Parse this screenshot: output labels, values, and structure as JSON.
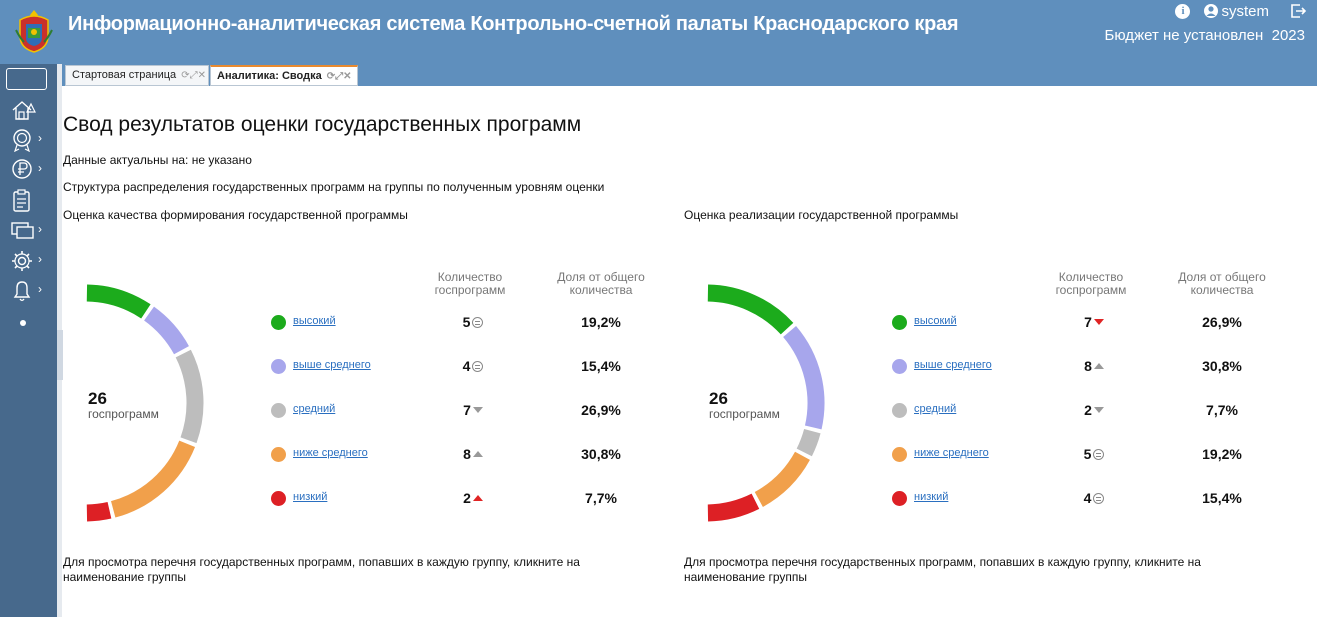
{
  "header": {
    "title": "Информационно-аналитическая система Контрольно-счетной палаты Краснодарского края",
    "user": "system",
    "budget_label": "Бюджет не установлен",
    "year": "2023"
  },
  "sidebar": {
    "items": [
      {
        "icon": "home-trees-icon"
      },
      {
        "icon": "award-icon"
      },
      {
        "icon": "ruble-icon"
      },
      {
        "icon": "clipboard-icon"
      },
      {
        "icon": "screens-icon"
      },
      {
        "icon": "gear-icon"
      },
      {
        "icon": "bell-icon"
      }
    ]
  },
  "tabs": [
    {
      "label": "Стартовая страница",
      "active": false
    },
    {
      "label": "Аналитика: Сводка",
      "active": true
    }
  ],
  "page": {
    "title": "Свод результатов оценки государственных программ",
    "actual_label": "Данные актуальны на:",
    "actual_value": "не указано",
    "structure_text": "Структура распределения государственных программ на группы по полученным уровням оценки"
  },
  "columns": {
    "count": "Количество госпрограмм",
    "share": "Доля от общего количества"
  },
  "colors": {
    "high": "#1cab1c",
    "above": "#a7a6ec",
    "mid": "#bdbdbd",
    "below": "#f1a04b",
    "low": "#dd2025"
  },
  "sections": [
    {
      "title": "Оценка качества формирования государственной программы",
      "total": "26",
      "total_label": "госпрограмм",
      "note": "Для просмотра перечня государственных программ, попавших в каждую группу, кликните на наименование группы",
      "rows": [
        {
          "key": "high",
          "label": "высокий",
          "count": "5",
          "count_value": 5,
          "trend": "equal",
          "share": "19,2%"
        },
        {
          "key": "above",
          "label": "выше среднего",
          "count": "4",
          "count_value": 4,
          "trend": "equal",
          "share": "15,4%"
        },
        {
          "key": "mid",
          "label": "средний",
          "count": "7",
          "count_value": 7,
          "trend": "down",
          "share": "26,9%"
        },
        {
          "key": "below",
          "label": "ниже среднего",
          "count": "8",
          "count_value": 8,
          "trend": "up",
          "share": "30,8%"
        },
        {
          "key": "low",
          "label": "низкий",
          "count": "2",
          "count_value": 2,
          "trend": "up-red",
          "share": "7,7%"
        }
      ]
    },
    {
      "title": "Оценка реализации государственной программы",
      "total": "26",
      "total_label": "госпрограмм",
      "note": "Для просмотра перечня государственных программ, попавших в каждую группу, кликните на наименование группы",
      "rows": [
        {
          "key": "high",
          "label": "высокий",
          "count": "7",
          "count_value": 7,
          "trend": "down-red",
          "share": "26,9%"
        },
        {
          "key": "above",
          "label": "выше среднего",
          "count": "8",
          "count_value": 8,
          "trend": "up",
          "share": "30,8%"
        },
        {
          "key": "mid",
          "label": "средний",
          "count": "2",
          "count_value": 2,
          "trend": "down",
          "share": "7,7%"
        },
        {
          "key": "below",
          "label": "ниже среднего",
          "count": "5",
          "count_value": 5,
          "trend": "equal",
          "share": "19,2%"
        },
        {
          "key": "low",
          "label": "низкий",
          "count": "4",
          "count_value": 4,
          "trend": "equal",
          "share": "15,4%"
        }
      ]
    }
  ]
}
